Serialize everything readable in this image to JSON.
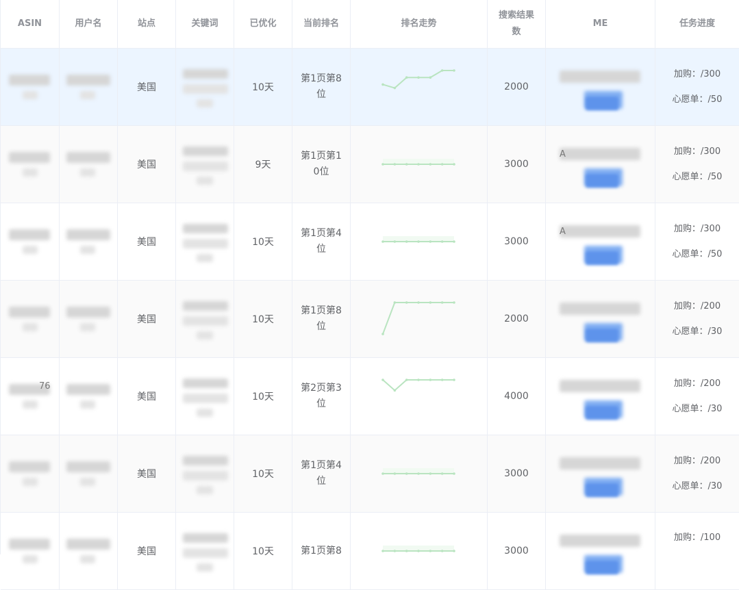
{
  "headers": [
    "ASIN",
    "用户名",
    "站点",
    "关键词",
    "已优化",
    "当前排名",
    "排名走势",
    "搜索结果数",
    "ME",
    "任务进度"
  ],
  "rows": [
    {
      "site": "美国",
      "optimized": "10天",
      "rank": "第1页第8位",
      "results": "2000",
      "cart": "加购：/300",
      "wish": "心愿单：/50",
      "trend": [
        4,
        5,
        2,
        2,
        2,
        0,
        0
      ],
      "me_prefix": "",
      "asin_tail": ""
    },
    {
      "site": "美国",
      "optimized": "9天",
      "rank": "第1页第10位",
      "results": "3000",
      "cart": "加购：/300",
      "wish": "心愿单：/50",
      "trend": [
        0,
        0,
        0,
        0,
        0,
        0,
        0
      ],
      "me_prefix": "A",
      "asin_tail": ""
    },
    {
      "site": "美国",
      "optimized": "10天",
      "rank": "第1页第4位",
      "results": "3000",
      "cart": "加购：/300",
      "wish": "心愿单：/50",
      "trend": [
        0,
        0,
        0,
        0,
        0,
        0,
        0
      ],
      "me_prefix": "A",
      "asin_tail": ""
    },
    {
      "site": "美国",
      "optimized": "10天",
      "rank": "第1页第8位",
      "results": "2000",
      "cart": "加购：/200",
      "wish": "心愿单：/30",
      "trend": [
        9,
        0,
        0,
        0,
        0,
        0,
        0
      ],
      "me_prefix": "",
      "asin_tail": ""
    },
    {
      "site": "美国",
      "optimized": "10天",
      "rank": "第2页第3位",
      "results": "4000",
      "cart": "加购：/200",
      "wish": "心愿单：/30",
      "trend": [
        0,
        3,
        0,
        0,
        0,
        0,
        0
      ],
      "me_prefix": "",
      "asin_tail": "76"
    },
    {
      "site": "美国",
      "optimized": "10天",
      "rank": "第1页第4位",
      "results": "3000",
      "cart": "加购：/200",
      "wish": "心愿单：/30",
      "trend": [
        0,
        0,
        0,
        0,
        0,
        0,
        0
      ],
      "me_prefix": "",
      "asin_tail": ""
    },
    {
      "site": "美国",
      "optimized": "10天",
      "rank": "第1页第8",
      "results": "3000",
      "cart": "加购：/100",
      "wish": "",
      "trend": [
        0,
        0,
        0,
        0,
        0,
        0,
        0
      ],
      "me_prefix": "",
      "asin_tail": ""
    }
  ],
  "colors": {
    "trend_line": "#b9e4c0",
    "row_highlight": "#ecf5ff",
    "row_stripe": "#fafafa",
    "header_text": "#909399",
    "body_text": "#606266",
    "border": "#ebeef5"
  }
}
